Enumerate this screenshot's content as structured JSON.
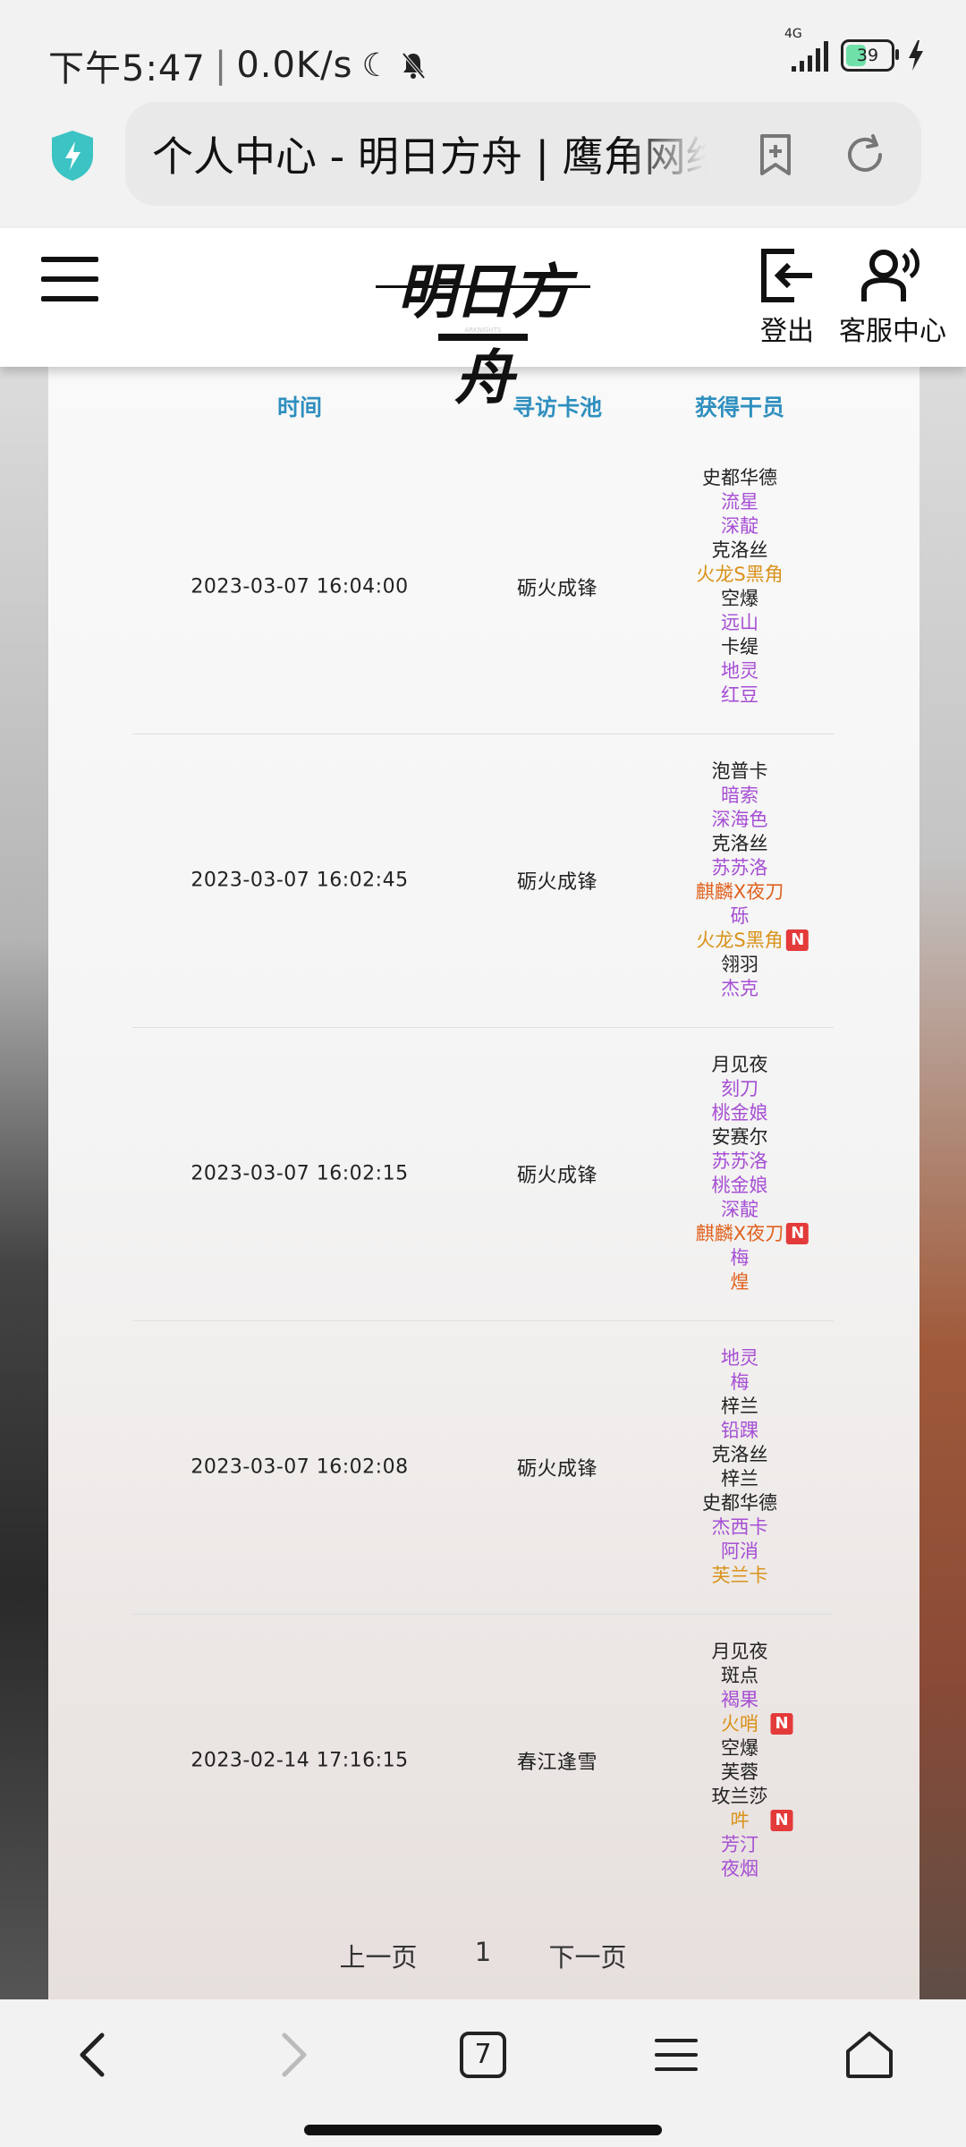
{
  "status": {
    "time": "下午5:47",
    "speed": "0.0K/s",
    "network": "4G",
    "battery": "39"
  },
  "browser": {
    "title": "个人中心 - 明日方舟 | 鹰角网络"
  },
  "header": {
    "logo_text": "明日方舟",
    "logo_sub": "ARKNIGHTS",
    "logout_label": "登出",
    "service_label": "客服中心"
  },
  "table": {
    "col_time": "时间",
    "col_pool": "寻访卡池",
    "col_ops": "获得干员",
    "rows": [
      {
        "time": "2023-03-07 16:04:00",
        "pool": "砺火成锋",
        "ops": [
          {
            "name": "史都华德",
            "rarity": 3,
            "new": false
          },
          {
            "name": "流星",
            "rarity": 4,
            "new": false
          },
          {
            "name": "深靛",
            "rarity": 4,
            "new": false
          },
          {
            "name": "克洛丝",
            "rarity": 3,
            "new": false
          },
          {
            "name": "火龙S黑角",
            "rarity": 5,
            "new": false
          },
          {
            "name": "空爆",
            "rarity": 3,
            "new": false
          },
          {
            "name": "远山",
            "rarity": 4,
            "new": false
          },
          {
            "name": "卡缇",
            "rarity": 3,
            "new": false
          },
          {
            "name": "地灵",
            "rarity": 4,
            "new": false
          },
          {
            "name": "红豆",
            "rarity": 4,
            "new": false
          }
        ]
      },
      {
        "time": "2023-03-07 16:02:45",
        "pool": "砺火成锋",
        "ops": [
          {
            "name": "泡普卡",
            "rarity": 3,
            "new": false
          },
          {
            "name": "暗索",
            "rarity": 4,
            "new": false
          },
          {
            "name": "深海色",
            "rarity": 4,
            "new": false
          },
          {
            "name": "克洛丝",
            "rarity": 3,
            "new": false
          },
          {
            "name": "苏苏洛",
            "rarity": 4,
            "new": false
          },
          {
            "name": "麒麟X夜刀",
            "rarity": 6,
            "new": false
          },
          {
            "name": "砾",
            "rarity": 4,
            "new": false
          },
          {
            "name": "火龙S黑角",
            "rarity": 5,
            "new": true
          },
          {
            "name": "翎羽",
            "rarity": 3,
            "new": false
          },
          {
            "name": "杰克",
            "rarity": 4,
            "new": false
          }
        ]
      },
      {
        "time": "2023-03-07 16:02:15",
        "pool": "砺火成锋",
        "ops": [
          {
            "name": "月见夜",
            "rarity": 3,
            "new": false
          },
          {
            "name": "刻刀",
            "rarity": 4,
            "new": false
          },
          {
            "name": "桃金娘",
            "rarity": 4,
            "new": false
          },
          {
            "name": "安赛尔",
            "rarity": 3,
            "new": false
          },
          {
            "name": "苏苏洛",
            "rarity": 4,
            "new": false
          },
          {
            "name": "桃金娘",
            "rarity": 4,
            "new": false
          },
          {
            "name": "深靛",
            "rarity": 4,
            "new": false
          },
          {
            "name": "麒麟X夜刀",
            "rarity": 6,
            "new": true
          },
          {
            "name": "梅",
            "rarity": 4,
            "new": false
          },
          {
            "name": "煌",
            "rarity": 6,
            "new": false
          }
        ]
      },
      {
        "time": "2023-03-07 16:02:08",
        "pool": "砺火成锋",
        "ops": [
          {
            "name": "地灵",
            "rarity": 4,
            "new": false
          },
          {
            "name": "梅",
            "rarity": 4,
            "new": false
          },
          {
            "name": "梓兰",
            "rarity": 3,
            "new": false
          },
          {
            "name": "铅踝",
            "rarity": 4,
            "new": false
          },
          {
            "name": "克洛丝",
            "rarity": 3,
            "new": false
          },
          {
            "name": "梓兰",
            "rarity": 3,
            "new": false
          },
          {
            "name": "史都华德",
            "rarity": 3,
            "new": false
          },
          {
            "name": "杰西卡",
            "rarity": 4,
            "new": false
          },
          {
            "name": "阿消",
            "rarity": 4,
            "new": false
          },
          {
            "name": "芙兰卡",
            "rarity": 5,
            "new": false
          }
        ]
      },
      {
        "time": "2023-02-14 17:16:15",
        "pool": "春江逢雪",
        "ops": [
          {
            "name": "月见夜",
            "rarity": 3,
            "new": false
          },
          {
            "name": "斑点",
            "rarity": 3,
            "new": false
          },
          {
            "name": "褐果",
            "rarity": 4,
            "new": false
          },
          {
            "name": "火哨",
            "rarity": 5,
            "new": true
          },
          {
            "name": "空爆",
            "rarity": 3,
            "new": false
          },
          {
            "name": "芙蓉",
            "rarity": 3,
            "new": false
          },
          {
            "name": "玫兰莎",
            "rarity": 3,
            "new": false
          },
          {
            "name": "吽",
            "rarity": 5,
            "new": true
          },
          {
            "name": "芳汀",
            "rarity": 4,
            "new": false
          },
          {
            "name": "夜烟",
            "rarity": 4,
            "new": false
          }
        ]
      }
    ]
  },
  "pager": {
    "prev": "上一页",
    "page": "1",
    "next": "下一页"
  },
  "nav": {
    "tabs_count": "7"
  },
  "badge_text": "N"
}
